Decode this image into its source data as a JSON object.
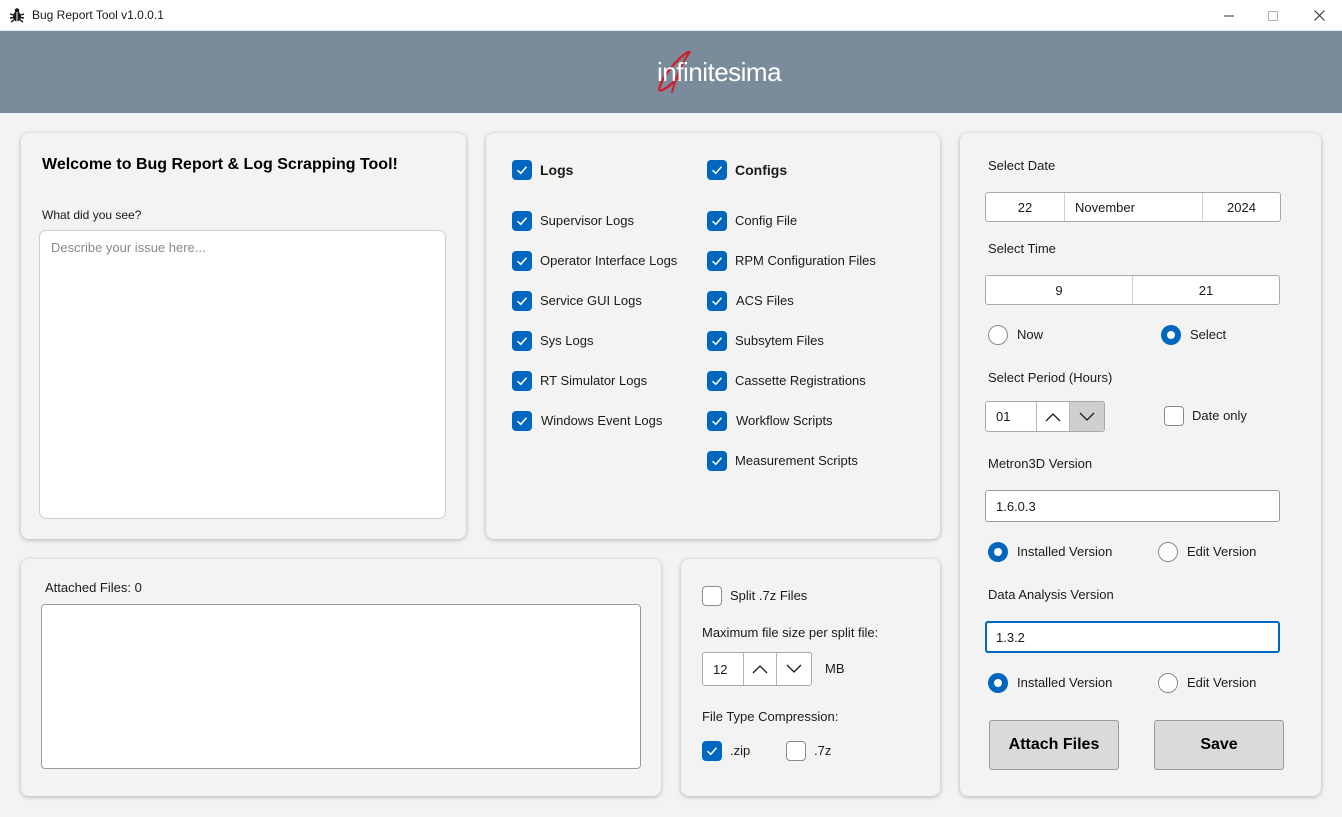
{
  "window": {
    "title": "Bug Report Tool v1.0.0.1",
    "app_icon": "bug-icon"
  },
  "banner": {
    "logo_text": "infinitesima",
    "logo_accent_color": "#d0202e",
    "background_color": "#7a8b9b"
  },
  "welcome": {
    "title": "Welcome to Bug Report & Log Scrapping Tool!",
    "prompt_label": "What did you see?",
    "description_placeholder": "Describe your issue here..."
  },
  "logs": {
    "header_label": "Logs",
    "items": [
      "Supervisor Logs",
      "Operator Interface Logs",
      "Service GUI Logs",
      "Sys Logs",
      "RT Simulator Logs",
      "Windows Event Logs"
    ]
  },
  "configs": {
    "header_label": "Configs",
    "items": [
      "Config File",
      "RPM Configuration Files",
      "ACS Files",
      "Subsytem Files",
      "Cassette Registrations",
      "Workflow Scripts",
      "Measurement Scripts"
    ]
  },
  "attached": {
    "label": "Attached Files: 0"
  },
  "compression": {
    "split_label": "Split .7z Files",
    "split_checked": false,
    "max_size_label": "Maximum file size per split file:",
    "max_size_value": "12",
    "max_size_unit": "MB",
    "type_label": "File Type Compression:",
    "zip_label": ".zip",
    "zip_checked": true,
    "sevenz_label": ".7z",
    "sevenz_checked": false
  },
  "settings": {
    "date_label": "Select Date",
    "date_day": "22",
    "date_month": "November",
    "date_year": "2024",
    "time_label": "Select Time",
    "time_hour": "9",
    "time_minute": "21",
    "now_label": "Now",
    "select_label": "Select",
    "time_mode": "Select",
    "period_label": "Select Period (Hours)",
    "period_value": "01",
    "date_only_label": "Date only",
    "date_only_checked": false,
    "metron_label": "Metron3D Version",
    "metron_value": "1.6.0.3",
    "metron_installed_label": "Installed Version",
    "metron_edit_label": "Edit Version",
    "metron_mode": "Installed Version",
    "analysis_label": "Data Analysis Version",
    "analysis_value": "1.3.2",
    "analysis_installed_label": "Installed Version",
    "analysis_edit_label": "Edit Version",
    "analysis_mode": "Installed Version",
    "attach_button": "Attach Files",
    "save_button": "Save"
  },
  "colors": {
    "accent": "#0067c0",
    "window_bg": "#f3f3f3"
  }
}
